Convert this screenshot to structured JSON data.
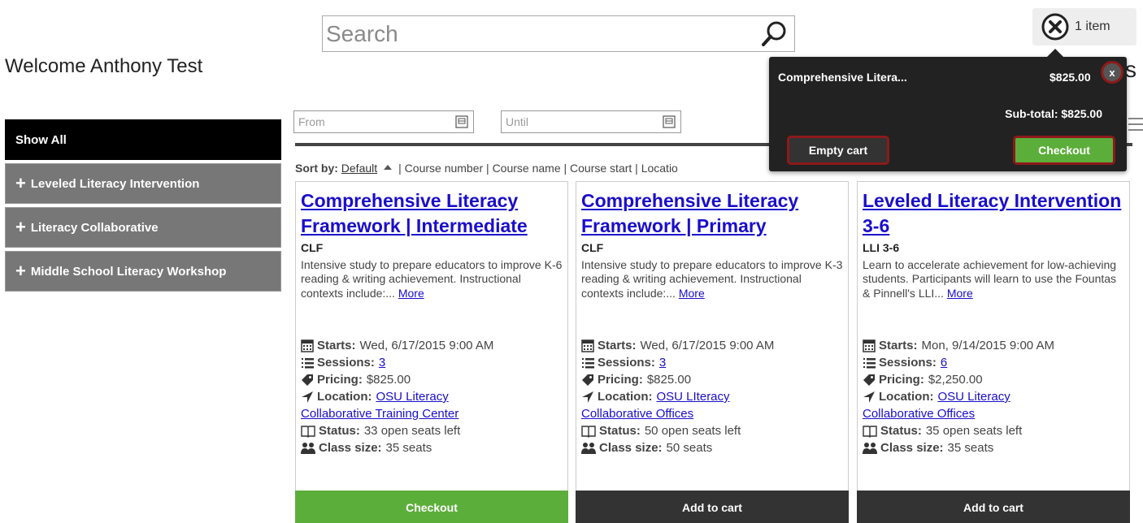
{
  "search": {
    "placeholder": "Search"
  },
  "welcome": "Welcome Anthony Test",
  "cart": {
    "count_label": "1 item"
  },
  "clipped_heading": "s",
  "sidebar": {
    "items": [
      {
        "label": "Show All"
      },
      {
        "label": "Leveled Literacy Intervention"
      },
      {
        "label": "Literacy Collaborative"
      },
      {
        "label": "Middle School Literacy Workshop"
      }
    ]
  },
  "filters": {
    "from_placeholder": "From",
    "until_placeholder": "Until"
  },
  "sort": {
    "label": "Sort by:",
    "default": "Default",
    "options_visible": "| Course number | Course name | Course start | Locatio"
  },
  "labels": {
    "starts": "Starts:",
    "sessions": "Sessions:",
    "pricing": "Pricing:",
    "location": "Location:",
    "status": "Status:",
    "class_size": "Class size:",
    "more": "More"
  },
  "courses": [
    {
      "title": "Comprehensive Literacy Framework | Intermediate",
      "code": "CLF",
      "description": "Intensive study to prepare educators to improve K-6 reading & writing achievement. Instructional contexts include:...",
      "starts": "Wed, 6/17/2015 9:00 AM",
      "sessions": "3",
      "pricing": "$825.00",
      "location_line1": "OSU Literacy",
      "location_line2": "Collaborative Training Center",
      "status": "33 open seats left",
      "class_size": "35 seats",
      "button": "Checkout"
    },
    {
      "title": "Comprehensive Literacy Framework | Primary",
      "code": "CLF",
      "description": "Intensive study to prepare educators to improve K-3 reading & writing achievement. Instructional contexts include:...",
      "starts": "Wed, 6/17/2015 9:00 AM",
      "sessions": "3",
      "pricing": "$825.00",
      "location_line1": "OSU LIteracy",
      "location_line2": "Collaborative Offices",
      "status": "50 open seats left",
      "class_size": "50 seats",
      "button": "Add to cart"
    },
    {
      "title": "Leveled Literacy Intervention 3-6",
      "code": "LLI 3-6",
      "description": "Learn to accelerate achievement for low-achieving students. Participants will learn to use the Fountas & Pinnell's LLI...",
      "starts": "Mon, 9/14/2015 9:00 AM",
      "sessions": "6",
      "pricing": "$2,250.00",
      "location_line1": "OSU Literacy",
      "location_line2": "Collaborative Offices",
      "status": "35 open seats left",
      "class_size": "35 seats",
      "button": "Add to cart"
    }
  ],
  "popup": {
    "item_name": "Comprehensive Litera...",
    "item_price": "$825.00",
    "close_label": "x",
    "subtotal": "Sub-total: $825.00",
    "empty_label": "Empty cart",
    "checkout_label": "Checkout"
  },
  "colors": {
    "link": "#1a0dcb",
    "checkout_green": "#5cae3a",
    "dark_button": "#333333",
    "highlight_border": "#8c1a1a"
  }
}
